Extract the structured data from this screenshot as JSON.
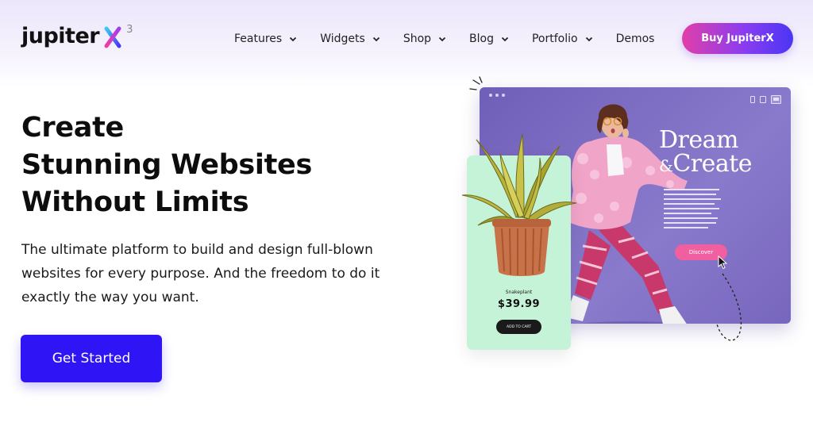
{
  "header": {
    "logo_text": "jupiter",
    "logo_version": "3",
    "nav": [
      {
        "label": "Features",
        "has_dropdown": true
      },
      {
        "label": "Widgets",
        "has_dropdown": true
      },
      {
        "label": "Shop",
        "has_dropdown": true
      },
      {
        "label": "Blog",
        "has_dropdown": true
      },
      {
        "label": "Portfolio",
        "has_dropdown": true
      },
      {
        "label": "Demos",
        "has_dropdown": false
      }
    ],
    "buy_label": "Buy JupiterX"
  },
  "hero": {
    "headline": [
      "Create",
      "Stunning Websites",
      "Without Limits"
    ],
    "subtext": [
      "The ultimate platform to build and design full-blown",
      "websites for every purpose. And the freedom to do it",
      "exactly the way you want."
    ],
    "cta_label": "Get Started"
  },
  "mockup": {
    "title_line1": "Dream",
    "title_amp": "&",
    "title_line2": "Create",
    "discover_label": "Discover"
  },
  "product_card": {
    "name": "Snakeplant",
    "price": "$39.99",
    "button_label": "ADD TO CART"
  },
  "colors": {
    "cta": "#2f14f5",
    "buy_gradient": [
      "#e13ea8",
      "#8b3df0",
      "#4a36f5"
    ],
    "mockup_bg": "#7a6ac4",
    "card_bg": "#c5f3d8",
    "discover": "#f05fa0"
  },
  "icons": [
    "chevron-down-icon",
    "logo-x-icon",
    "mobile-icon",
    "tablet-icon",
    "desktop-icon",
    "cursor-icon"
  ]
}
